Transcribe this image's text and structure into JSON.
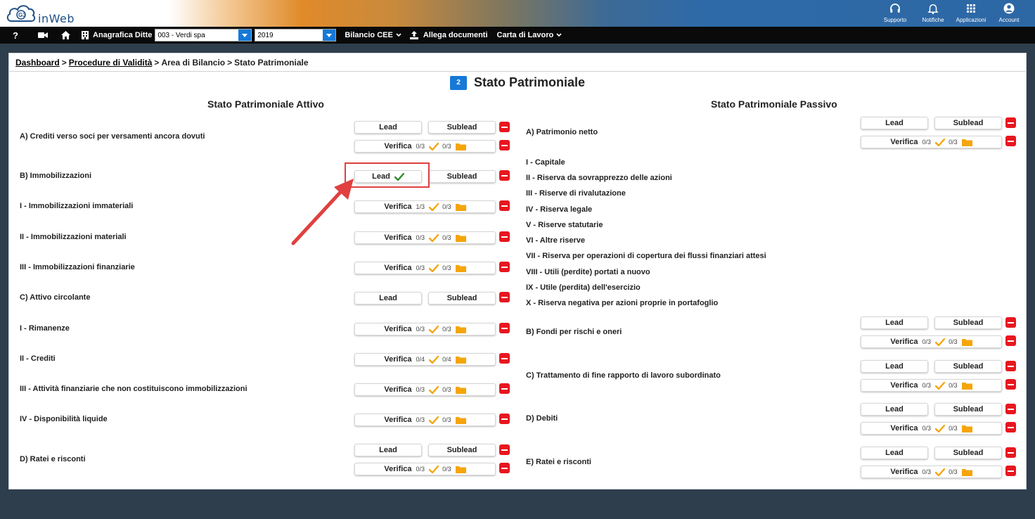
{
  "header": {
    "logo_text": "inWeb",
    "logo_badge": "G3",
    "icons": [
      {
        "name": "headset-icon",
        "label": "Supporto"
      },
      {
        "name": "bell-icon",
        "label": "Notifiche"
      },
      {
        "name": "grid-icon",
        "label": "Applicazioni"
      },
      {
        "name": "account-icon",
        "label": "Account"
      }
    ]
  },
  "nav": {
    "help": "?",
    "anagrafica_label": "Anagrafica Ditte",
    "company_select": "003 - Verdi spa",
    "year_select": "2019",
    "bilancio_label": "Bilancio CEE",
    "allega_label": "Allega documenti",
    "carta_label": "Carta di Lavoro"
  },
  "breadcrumb": {
    "dashboard": "Dashboard",
    "procedure": "Procedure di Validità",
    "area": "Area di Bilancio",
    "current": "Stato Patrimoniale",
    "sep": ">"
  },
  "page": {
    "badge": "2",
    "title": "Stato Patrimoniale",
    "attivo_title": "Stato Patrimoniale Attivo",
    "passivo_title": "Stato Patrimoniale Passivo"
  },
  "labels": {
    "lead": "Lead",
    "sublead": "Sublead",
    "verifica": "Verifica"
  },
  "attivo": [
    {
      "label": "A) Crediti verso soci per versamenti ancora dovuti",
      "type": "lead-verifica",
      "c1": "0/3",
      "c2": "0/3"
    },
    {
      "label": "B) Immobilizzazioni",
      "type": "lead-done"
    },
    {
      "label": "I - Immobilizzazioni immateriali",
      "type": "verifica",
      "c1": "1/3",
      "c2": "0/3"
    },
    {
      "label": "II - Immobilizzazioni materiali",
      "type": "verifica",
      "c1": "0/3",
      "c2": "0/3"
    },
    {
      "label": "III - Immobilizzazioni finanziarie",
      "type": "verifica",
      "c1": "0/3",
      "c2": "0/3"
    },
    {
      "label": "C) Attivo circolante",
      "type": "lead"
    },
    {
      "label": "I - Rimanenze",
      "type": "verifica",
      "c1": "0/3",
      "c2": "0/3"
    },
    {
      "label": "II - Crediti",
      "type": "verifica",
      "c1": "0/4",
      "c2": "0/4"
    },
    {
      "label": "III - Attività finanziarie che non costituiscono immobilizzazioni",
      "type": "verifica",
      "c1": "0/3",
      "c2": "0/3"
    },
    {
      "label": "IV - Disponibilità liquide",
      "type": "verifica",
      "c1": "0/3",
      "c2": "0/3"
    },
    {
      "label": "D) Ratei e risconti",
      "type": "lead-verifica",
      "c1": "0/3",
      "c2": "0/3"
    }
  ],
  "passivo": [
    {
      "label": "A) Patrimonio netto",
      "type": "lead-verifica",
      "c1": "0/3",
      "c2": "0/3"
    },
    {
      "label": "I - Capitale",
      "type": "text"
    },
    {
      "label": "II - Riserva da sovrapprezzo delle azioni",
      "type": "text"
    },
    {
      "label": "III - Riserve di rivalutazione",
      "type": "text"
    },
    {
      "label": "IV - Riserva legale",
      "type": "text"
    },
    {
      "label": "V - Riserve statutarie",
      "type": "text"
    },
    {
      "label": "VI - Altre riserve",
      "type": "text"
    },
    {
      "label": "VII - Riserva per operazioni di copertura dei flussi finanziari attesi",
      "type": "text"
    },
    {
      "label": "VIII - Utili (perdite) portati a nuovo",
      "type": "text"
    },
    {
      "label": "IX - Utile (perdita) dell'esercizio",
      "type": "text"
    },
    {
      "label": "X - Riserva negativa per azioni proprie in portafoglio",
      "type": "text"
    },
    {
      "label": "B) Fondi per rischi e oneri",
      "type": "lead-verifica",
      "c1": "0/3",
      "c2": "0/3"
    },
    {
      "label": "C) Trattamento di fine rapporto di lavoro subordinato",
      "type": "lead-verifica",
      "c1": "0/3",
      "c2": "0/3"
    },
    {
      "label": "D) Debiti",
      "type": "lead-verifica",
      "c1": "0/3",
      "c2": "0/3"
    },
    {
      "label": "E) Ratei e risconti",
      "type": "lead-verifica",
      "c1": "0/3",
      "c2": "0/3"
    }
  ],
  "colors": {
    "accent": "#1679d8",
    "danger": "#e8161f",
    "check": "#f5a50b",
    "check_done": "#2e8b2e",
    "folder": "#f5a50b",
    "annotation": "#e04040"
  }
}
